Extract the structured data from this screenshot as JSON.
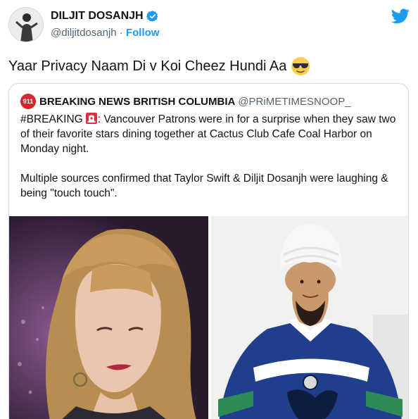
{
  "author": {
    "display_name": "DILJIT DOSANJH",
    "handle": "@diljitdosanjh",
    "separator": " · ",
    "follow_label": "Follow"
  },
  "tweet": {
    "text": "Yaar Privacy Naam Di v Koi Cheez Hundi Aa"
  },
  "quoted_tweet": {
    "avatar_text": "911",
    "name": "BREAKING NEWS BRITISH COLUMBIA",
    "handle": "@PRiMETIMESNOOP_",
    "para1_a": "#BREAKING",
    "para1_b": ":  Vancouver Patrons were in for a surprise when they saw two of their favorite stars dining together at  Cactus Club Cafe Coal Harbor on Monday night.",
    "para2": "Multiple sources confirmed that Taylor Swift & Diljit Dosanjh were laughing & being \"touch touch\"."
  },
  "icons": {
    "verified": "verified-badge-icon",
    "twitter": "twitter-bird-icon",
    "emoji": "sunglasses-emoji-icon",
    "siren": "police-siren-emoji-icon"
  },
  "colors": {
    "accent": "#1d9bf0",
    "text": "#0f1419",
    "muted": "#536471",
    "border": "#cfd9de"
  }
}
